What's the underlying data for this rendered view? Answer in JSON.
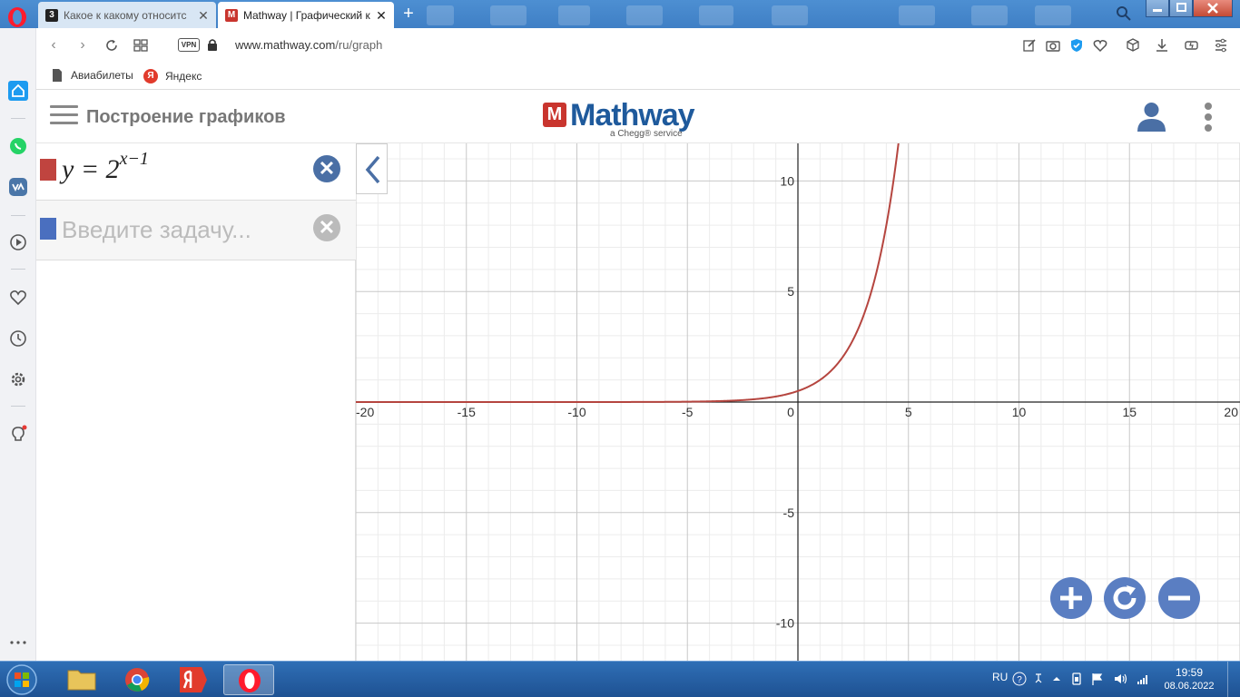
{
  "browser": {
    "tabs": [
      {
        "title": "Какое к какому относитс",
        "favicon": "znanija-icon",
        "active": false
      },
      {
        "title": "Mathway | Графический ка",
        "favicon": "mathway-icon",
        "active": true
      }
    ],
    "url_domain": "www.mathway.com",
    "url_path": "/ru/graph",
    "vpn_label": "VPN",
    "bookmarks": [
      {
        "label": "Авиабилеты",
        "icon": "document-icon"
      },
      {
        "label": "Яндекс",
        "icon": "yandex-icon",
        "icon_letter": "Я"
      }
    ]
  },
  "header": {
    "title": "Построение графиков",
    "logo_text": "Mathway",
    "logo_letter": "M",
    "logo_tagline": "a Chegg® service"
  },
  "expressions": [
    {
      "color": "#c0443f",
      "base": "y = 2",
      "exponent": "x−1",
      "clear_symbol": "✕"
    },
    {
      "color": "#4a6fbf",
      "placeholder": "Введите задачу...",
      "clear_symbol": "✕"
    }
  ],
  "graph": {
    "xlim": [
      -20,
      20
    ],
    "ylim": [
      -11.7,
      11.7
    ],
    "x_ticks": [
      -20,
      -15,
      -10,
      -5,
      0,
      5,
      10,
      15,
      20
    ],
    "x_tick_labels": [
      "-20",
      "-15",
      "-10",
      "-5",
      "0",
      "5",
      "10",
      "15",
      "20"
    ],
    "y_ticks": [
      -10,
      -5,
      5,
      10
    ],
    "y_tick_labels": [
      "-10",
      "-5",
      "5",
      "10"
    ],
    "minor_step": 1,
    "major_step": 5,
    "curve_color": "#b5453f",
    "function": "2^(x-1)"
  },
  "zoom_controls": [
    {
      "name": "zoom-in-button",
      "symbol": "+"
    },
    {
      "name": "reset-button",
      "symbol": "↻"
    },
    {
      "name": "zoom-out-button",
      "symbol": "−"
    }
  ],
  "taskbar": {
    "language": "RU",
    "time": "19:59",
    "date": "08.06.2022"
  }
}
